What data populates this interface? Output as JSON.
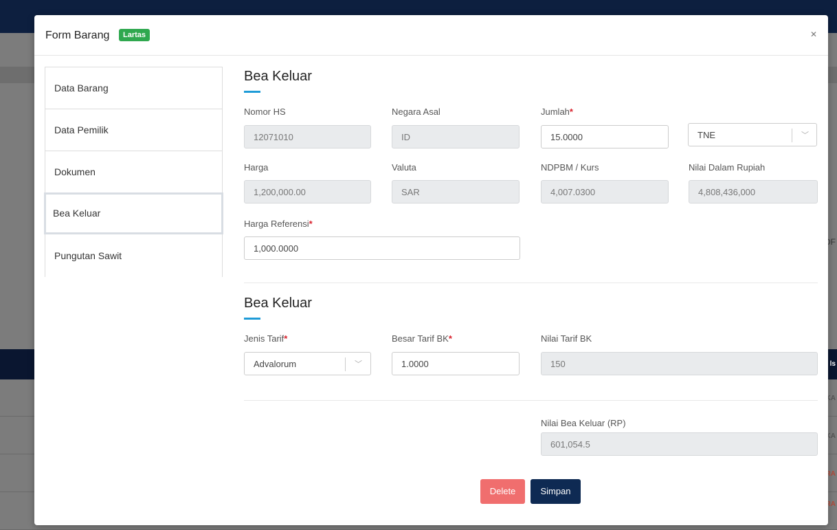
{
  "modal": {
    "title": "Form Barang",
    "badge": "Lartas",
    "close_icon": "close-icon"
  },
  "sidenav": {
    "items": [
      {
        "label": "Data Barang"
      },
      {
        "label": "Data Pemilik"
      },
      {
        "label": "Dokumen"
      },
      {
        "label": "Bea Keluar"
      },
      {
        "label": "Pungutan Sawit"
      }
    ],
    "active": "Bea Keluar"
  },
  "section1": {
    "title": "Bea Keluar",
    "nomor_hs": {
      "label": "Nomor HS",
      "value": "12071010"
    },
    "negara_asal": {
      "label": "Negara Asal",
      "value": "ID"
    },
    "jumlah": {
      "label": "Jumlah",
      "value": "15.0000"
    },
    "satuan": {
      "value": "TNE"
    },
    "harga": {
      "label": "Harga",
      "value": "1,200,000.00"
    },
    "valuta": {
      "label": "Valuta",
      "value": "SAR"
    },
    "ndpbm": {
      "label": "NDPBM / Kurs",
      "value": "4,007.0300"
    },
    "nilai_rupiah": {
      "label": "Nilai Dalam Rupiah",
      "value": "4,808,436,000"
    },
    "harga_referensi": {
      "label": "Harga Referensi",
      "value": "1,000.0000"
    }
  },
  "section2": {
    "title": "Bea Keluar",
    "jenis_tarif": {
      "label": "Jenis Tarif",
      "value": "Advalorum"
    },
    "besar_tarif": {
      "label": "Besar Tarif BK",
      "value": "1.0000"
    },
    "nilai_tarif": {
      "label": "Nilai Tarif BK",
      "value": "150"
    },
    "nilai_bea_keluar": {
      "label": "Nilai Bea Keluar (RP)",
      "value": "601,054.5"
    }
  },
  "required_mark": "*",
  "buttons": {
    "delete": "Delete",
    "simpan": "Simpan"
  },
  "background": {
    "edge_texts": [
      "DF",
      "ls",
      "KA",
      "KA",
      "RA",
      "RA"
    ]
  },
  "colors": {
    "accent": "#1e9bd7",
    "badge": "#2fa84f",
    "delete": "#f06e6e",
    "primary": "#0e2a53",
    "required": "#d9232e"
  }
}
